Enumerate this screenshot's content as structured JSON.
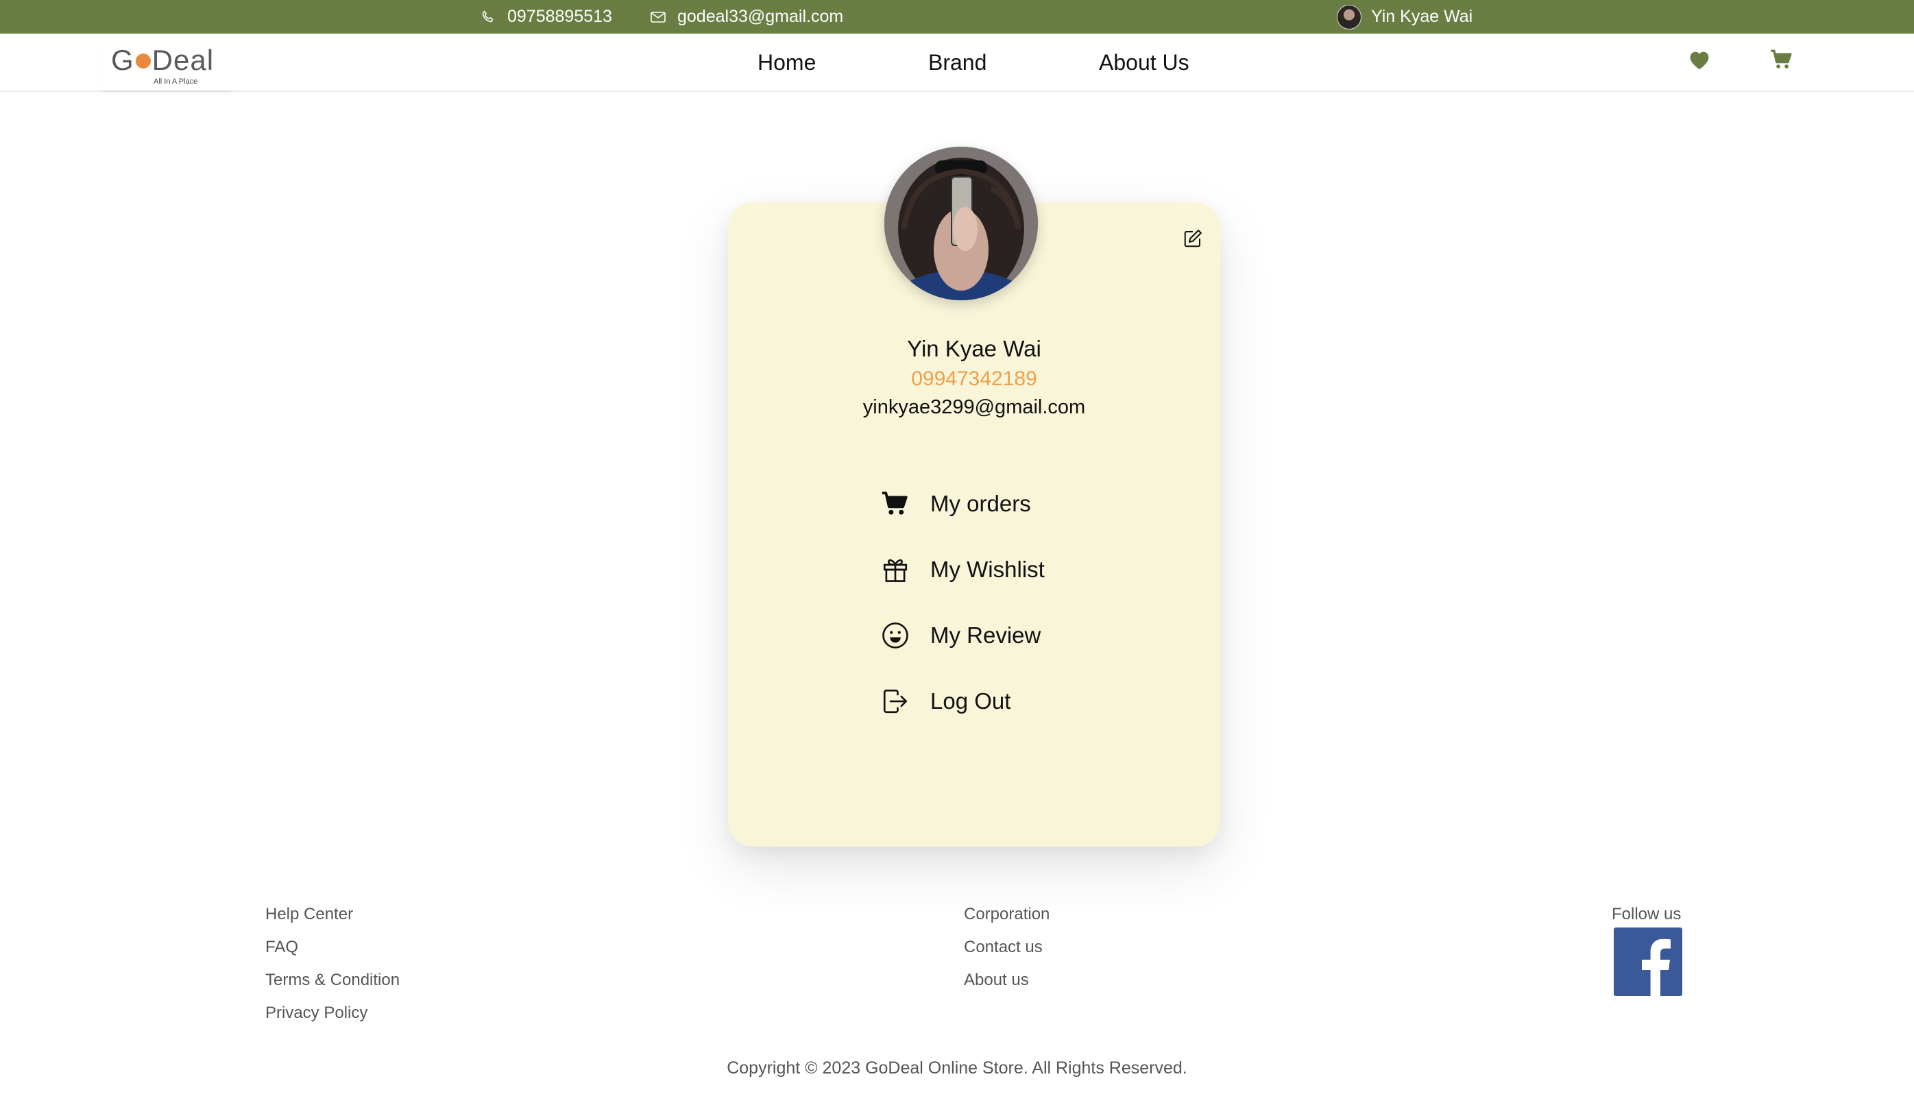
{
  "topbar": {
    "phone": "09758895513",
    "email": "godeal33@gmail.com",
    "user_name": "Yin Kyae Wai"
  },
  "brand": {
    "name_parts": [
      "G",
      "Deal"
    ],
    "tagline": "All In A Place"
  },
  "nav": {
    "links": [
      "Home",
      "Brand",
      "About Us"
    ],
    "icons": [
      "heart-icon",
      "cart-icon"
    ]
  },
  "profile": {
    "name": "Yin Kyae Wai",
    "phone": "09947342189",
    "email": "yinkyae3299@gmail.com",
    "edit_icon": "edit-icon"
  },
  "menu": [
    {
      "label": "My orders",
      "icon": "cart-icon"
    },
    {
      "label": "My Wishlist",
      "icon": "gift-icon"
    },
    {
      "label": "My Review",
      "icon": "smile-icon"
    },
    {
      "label": "Log Out",
      "icon": "logout-icon"
    }
  ],
  "footer": {
    "col1": [
      "Help Center",
      "FAQ",
      "Terms & Condition",
      "Privacy Policy"
    ],
    "col2": [
      "Corporation",
      "Contact us",
      "About us"
    ],
    "follow_label": "Follow us",
    "social_icon": "facebook-icon",
    "copyright": "Copyright © 2023 GoDeal Online Store. All Rights Reserved."
  },
  "colors": {
    "topbar": "#6a7d42",
    "accent": "#f0a04a",
    "card": "#f8f5d9",
    "facebook": "#3b5998"
  }
}
